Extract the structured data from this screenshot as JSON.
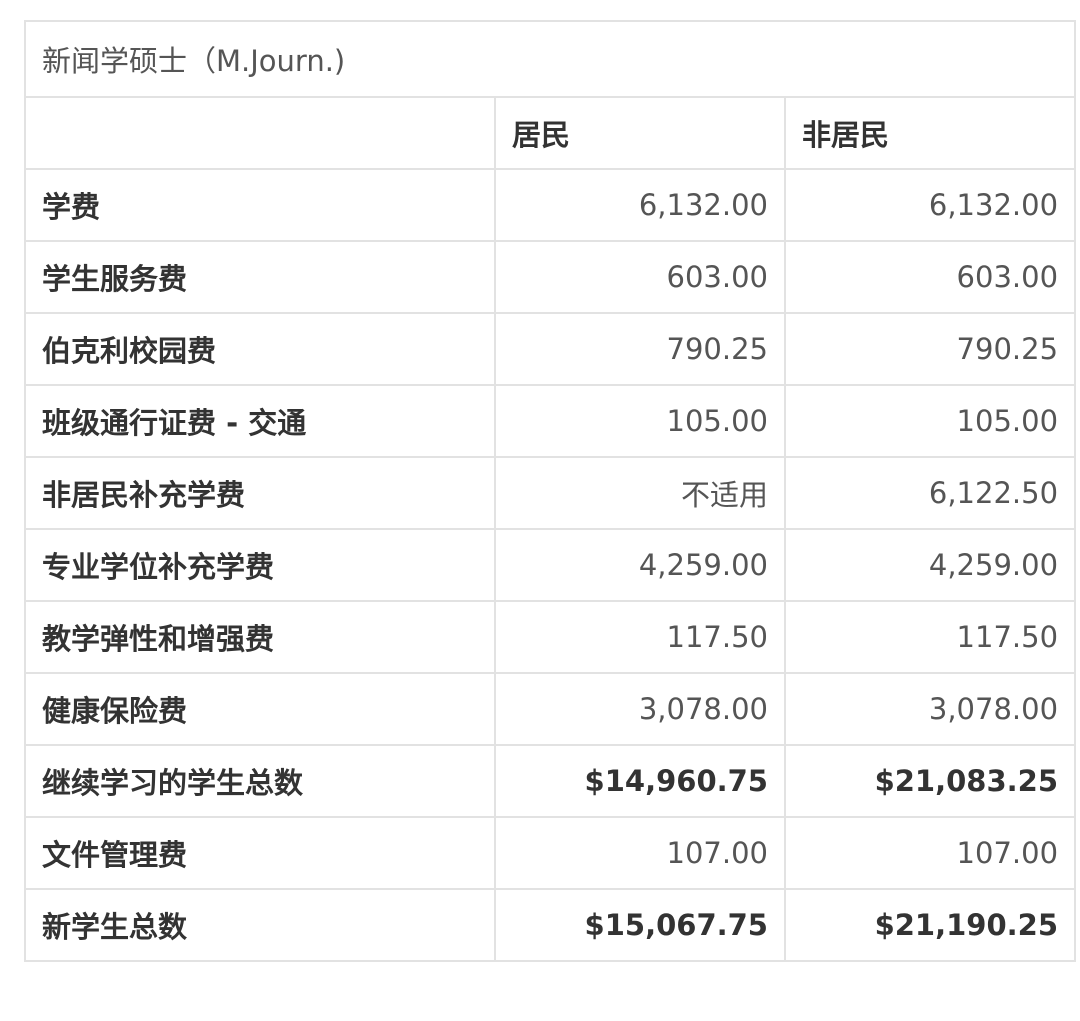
{
  "table": {
    "caption": "新闻学硕士（M.Journ.)",
    "columns": [
      "",
      "居民",
      "非居民"
    ],
    "rows": [
      {
        "label": "学费",
        "resident": "6,132.00",
        "nonresident": "6,132.00",
        "bold": false
      },
      {
        "label": "学生服务费",
        "resident": "603.00",
        "nonresident": "603.00",
        "bold": false
      },
      {
        "label": "伯克利校园费",
        "resident": "790.25",
        "nonresident": "790.25",
        "bold": false
      },
      {
        "label": "班级通行证费 - 交通",
        "resident": "105.00",
        "nonresident": "105.00",
        "bold": false
      },
      {
        "label": "非居民补充学费",
        "resident": "不适用",
        "nonresident": "6,122.50",
        "bold": false
      },
      {
        "label": "专业学位补充学费",
        "resident": "4,259.00",
        "nonresident": "4,259.00",
        "bold": false
      },
      {
        "label": "教学弹性和增强费",
        "resident": "117.50",
        "nonresident": "117.50",
        "bold": false
      },
      {
        "label": "健康保险费",
        "resident": "3,078.00",
        "nonresident": "3,078.00",
        "bold": false
      },
      {
        "label": "继续学习的学生总数",
        "resident": "$14,960.75",
        "nonresident": "$21,083.25",
        "bold": true
      },
      {
        "label": "文件管理费",
        "resident": "107.00",
        "nonresident": "107.00",
        "bold": false
      },
      {
        "label": "新学生总数",
        "resident": "$15,067.75",
        "nonresident": "$21,190.25",
        "bold": true
      }
    ]
  }
}
